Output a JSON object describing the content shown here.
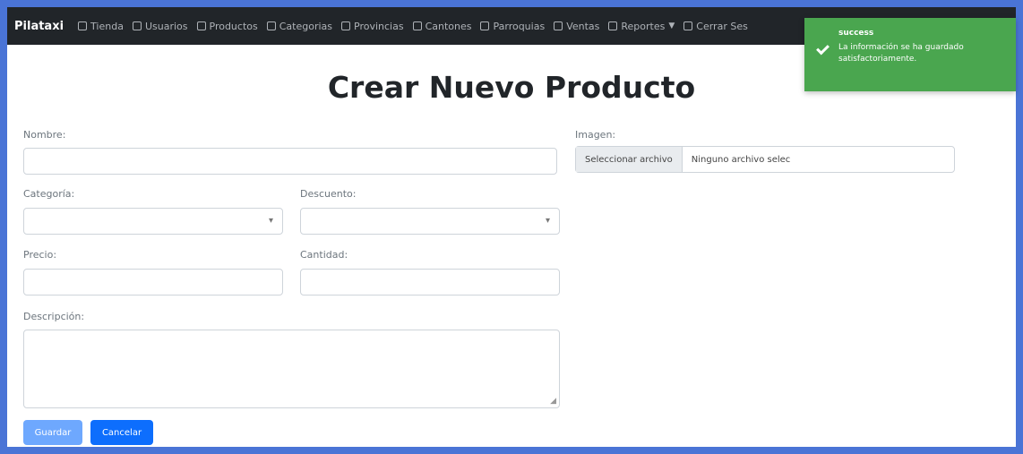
{
  "app": {
    "brand": "Pilataxi"
  },
  "nav": {
    "items": [
      {
        "label": "Tienda"
      },
      {
        "label": "Usuarios"
      },
      {
        "label": "Productos"
      },
      {
        "label": "Categorias"
      },
      {
        "label": "Provincias"
      },
      {
        "label": "Cantones"
      },
      {
        "label": "Parroquias"
      },
      {
        "label": "Ventas"
      },
      {
        "label": "Reportes"
      },
      {
        "label": "Cerrar Ses"
      }
    ]
  },
  "page": {
    "title": "Crear Nuevo Producto"
  },
  "form": {
    "nombre_label": "Nombre:",
    "imagen_label": "Imagen:",
    "file_button": "Seleccionar archivo",
    "file_status": "Ninguno archivo selec",
    "categoria_label": "Categoría:",
    "descuento_label": "Descuento:",
    "precio_label": "Precio:",
    "cantidad_label": "Cantidad:",
    "descripcion_label": "Descripción:",
    "save_label": "Guardar",
    "cancel_label": "Cancelar"
  },
  "toast": {
    "title": "success",
    "message": "La información se ha guardado satisfactoriamente.",
    "color": "#4aa64f"
  }
}
